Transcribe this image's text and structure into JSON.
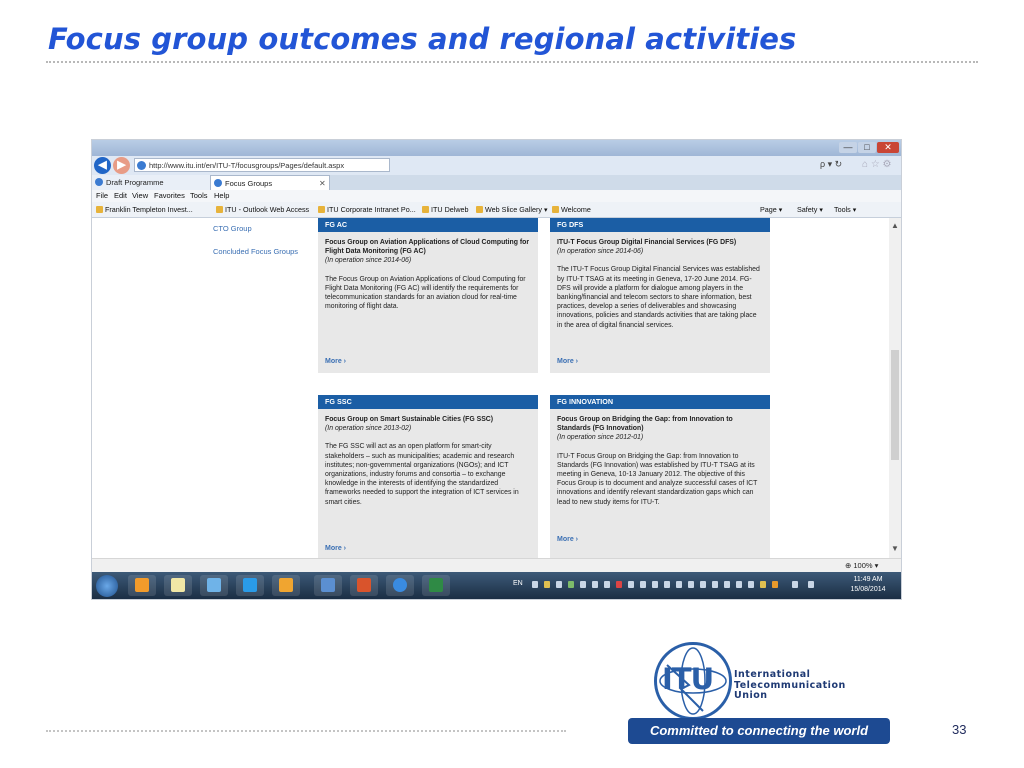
{
  "slide": {
    "title": "Focus group outcomes and regional activities",
    "page_number": "33"
  },
  "browser": {
    "window_controls": {
      "minimize": "—",
      "maximize": "□",
      "close": "✕"
    },
    "url": "http://www.itu.int/en/ITU-T/focusgroups/Pages/default.aspx",
    "tabs": [
      {
        "label": "Draft Programme",
        "close": "✕"
      },
      {
        "label": "Focus Groups",
        "close": "✕"
      }
    ],
    "menu": [
      "File",
      "Edit",
      "View",
      "Favorites",
      "Tools",
      "Help"
    ],
    "favorites": [
      "Franklin Templeton Invest...",
      "ITU - Outlook Web Access",
      "ITU Corporate Intranet Po...",
      "ITU Delweb",
      "Web Slice Gallery ▾",
      "Welcome"
    ],
    "command_bar": {
      "page": "Page ▾",
      "safety": "Safety ▾",
      "tools": "Tools ▾"
    },
    "zoom": "100%",
    "search_refresh": "ρ ▾ ↻",
    "home_icons": "⌂ ☆ ⚙"
  },
  "sidebar": {
    "links": [
      "CTO Group",
      "Concluded Focus Groups"
    ]
  },
  "cards": [
    {
      "header": "FG AC",
      "title": "Focus Group on Aviation Applications of Cloud Computing for Flight Data Monitoring (FG AC)",
      "since": "(In operation since 2014-06)",
      "desc": "The Focus Group on Aviation Applications of Cloud Computing for Flight Data Monitoring (FG AC) will identify the requirements for telecommunication standards for an aviation cloud for real-time monitoring of flight data.",
      "more": "More ›"
    },
    {
      "header": "FG DFS",
      "title": "ITU-T Focus Group Digital Financial Services (FG DFS)",
      "since": "(In operation since 2014-06)",
      "desc": "The ITU-T Focus Group Digital Financial Services was established by ITU-T TSAG at its meeting in Geneva, 17-20 June 2014. FG-DFS will provide a platform for dialogue among players in the banking/financial and telecom sectors to share information, best practices, develop a series of deliverables and showcasing innovations, policies and standards activities that are taking place in the area of digital financial services.",
      "more": "More ›"
    },
    {
      "header": "FG SSC",
      "title": "Focus Group on Smart Sustainable Cities (FG SSC)",
      "since": "(In operation since 2013-02)",
      "desc": "The FG SSC will act as an open platform for smart-city stakeholders – such as municipalities; academic and research institutes; non-governmental organizations (NGOs); and ICT organizations, industry forums and consortia – to exchange knowledge in the interests of identifying the standardized frameworks needed to support the integration of ICT services in smart cities.",
      "more": "More ›"
    },
    {
      "header": "FG INNOVATION",
      "title": "Focus Group on Bridging the Gap: from Innovation to Standards (FG Innovation)",
      "since": "(In operation since 2012-01)",
      "desc": "ITU-T Focus Group on Bridging the Gap: from Innovation to Standards (FG Innovation) was established by ITU-T TSAG at its meeting in Geneva, 10-13 January 2012. The objective of this Focus Group is to document and analyze successful cases of ICT innovations and identify relevant standardization gaps which can lead to new study items for ITU-T.",
      "more": "More ›"
    }
  ],
  "taskbar": {
    "language": "EN",
    "time": "11:49 AM",
    "date": "15/08/2014"
  },
  "logo": {
    "letters": "ITU",
    "org_line1": "International",
    "org_line2": "Telecommunication",
    "org_line3": "Union",
    "tagline": "Committed to connecting the world"
  },
  "colors": {
    "title": "#2255d6",
    "card_header": "#1b5ea5",
    "card_bg": "#e8e8e8",
    "link": "#3a6fb3",
    "itu_blue": "#1d4a92"
  }
}
